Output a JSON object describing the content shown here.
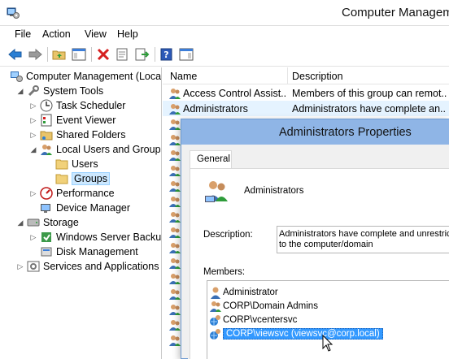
{
  "window": {
    "title": "Computer Managem",
    "icon": "computer-management-icon"
  },
  "menu": [
    "File",
    "Action",
    "View",
    "Help"
  ],
  "toolbar": [
    "back-arrow-icon",
    "forward-arrow-icon",
    "up-folder-icon",
    "show-hide-tree-icon",
    "delete-icon",
    "properties-icon",
    "export-list-icon",
    "help-icon",
    "show-action-pane-icon"
  ],
  "tree": {
    "root": "Computer Management (Local",
    "system_tools": "System Tools",
    "task_scheduler": "Task Scheduler",
    "event_viewer": "Event Viewer",
    "shared_folders": "Shared Folders",
    "local_users_groups": "Local Users and Groups",
    "users": "Users",
    "groups": "Groups",
    "performance": "Performance",
    "device_manager": "Device Manager",
    "storage": "Storage",
    "windows_server_backup": "Windows Server Backup",
    "disk_management": "Disk Management",
    "services_apps": "Services and Applications"
  },
  "list": {
    "col_name": "Name",
    "col_description": "Description",
    "rows": [
      {
        "name": "Access Control Assist...",
        "description": "Members of this group can remot..."
      },
      {
        "name": "Administrators",
        "description": "Administrators have complete an..."
      }
    ]
  },
  "dialog": {
    "title": "Administrators Properties",
    "tab": "General",
    "group_name": "Administrators",
    "description_label": "Description:",
    "description_line1": "Administrators have complete and unrestricted",
    "description_line2": "to the computer/domain",
    "members_label": "Members:",
    "members": [
      {
        "text": "Administrator",
        "icon": "user-icon"
      },
      {
        "text": "CORP\\Domain Admins",
        "icon": "group-icon"
      },
      {
        "text": "CORP\\vcentersvc",
        "icon": "domain-user-icon"
      },
      {
        "text": "CORP\\viewsvc (viewsvc@corp.local)",
        "icon": "domain-user-icon"
      }
    ]
  },
  "colors": {
    "selection": "#3399ff",
    "dialog_title": "#8fb5e6",
    "tree_selection": "#cce8ff"
  }
}
